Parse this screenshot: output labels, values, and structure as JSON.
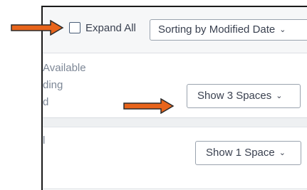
{
  "toolbar": {
    "expand_all_label": "Expand All",
    "sort_label": "Sorting by Modified Date"
  },
  "rows": [
    {
      "status_lines": [
        "Available",
        "ding",
        "d"
      ],
      "button_label": "Show 3 Spaces"
    },
    {
      "status_lines": [
        "l"
      ],
      "button_label": "Show 1 Space"
    }
  ],
  "annotations": {
    "arrow_color": "#e8641b"
  }
}
